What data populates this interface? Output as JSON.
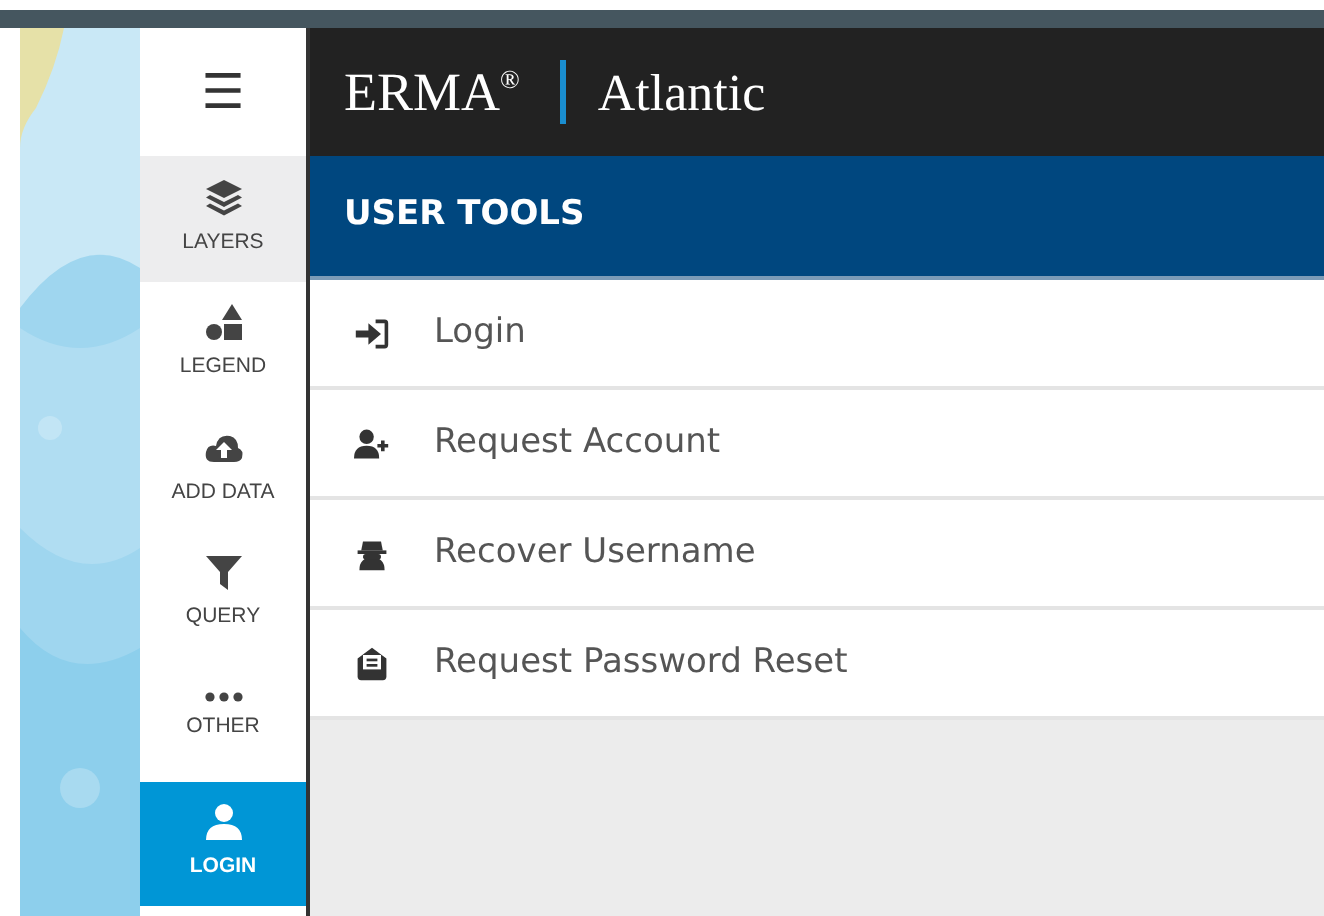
{
  "brand": {
    "name": "ERMA",
    "mark": "®",
    "region": "Atlantic"
  },
  "sidebar": {
    "menu_icon": "☰",
    "items": [
      {
        "label": "LAYERS",
        "kind": "layers",
        "selected": false,
        "highlighted": true
      },
      {
        "label": "LEGEND",
        "kind": "legend",
        "selected": false,
        "highlighted": false
      },
      {
        "label": "ADD DATA",
        "kind": "upload",
        "selected": false,
        "highlighted": false
      },
      {
        "label": "QUERY",
        "kind": "filter",
        "selected": false,
        "highlighted": false
      },
      {
        "label": "OTHER",
        "kind": "more",
        "selected": false,
        "highlighted": false
      },
      {
        "label": "LOGIN",
        "kind": "user",
        "selected": true,
        "highlighted": false
      }
    ]
  },
  "panel": {
    "title": "USER TOOLS",
    "items": [
      {
        "label": "Login",
        "kind": "signin"
      },
      {
        "label": "Request Account",
        "kind": "adduser"
      },
      {
        "label": "Recover Username",
        "kind": "spy"
      },
      {
        "label": "Request Password Reset",
        "kind": "envelope"
      }
    ]
  }
}
